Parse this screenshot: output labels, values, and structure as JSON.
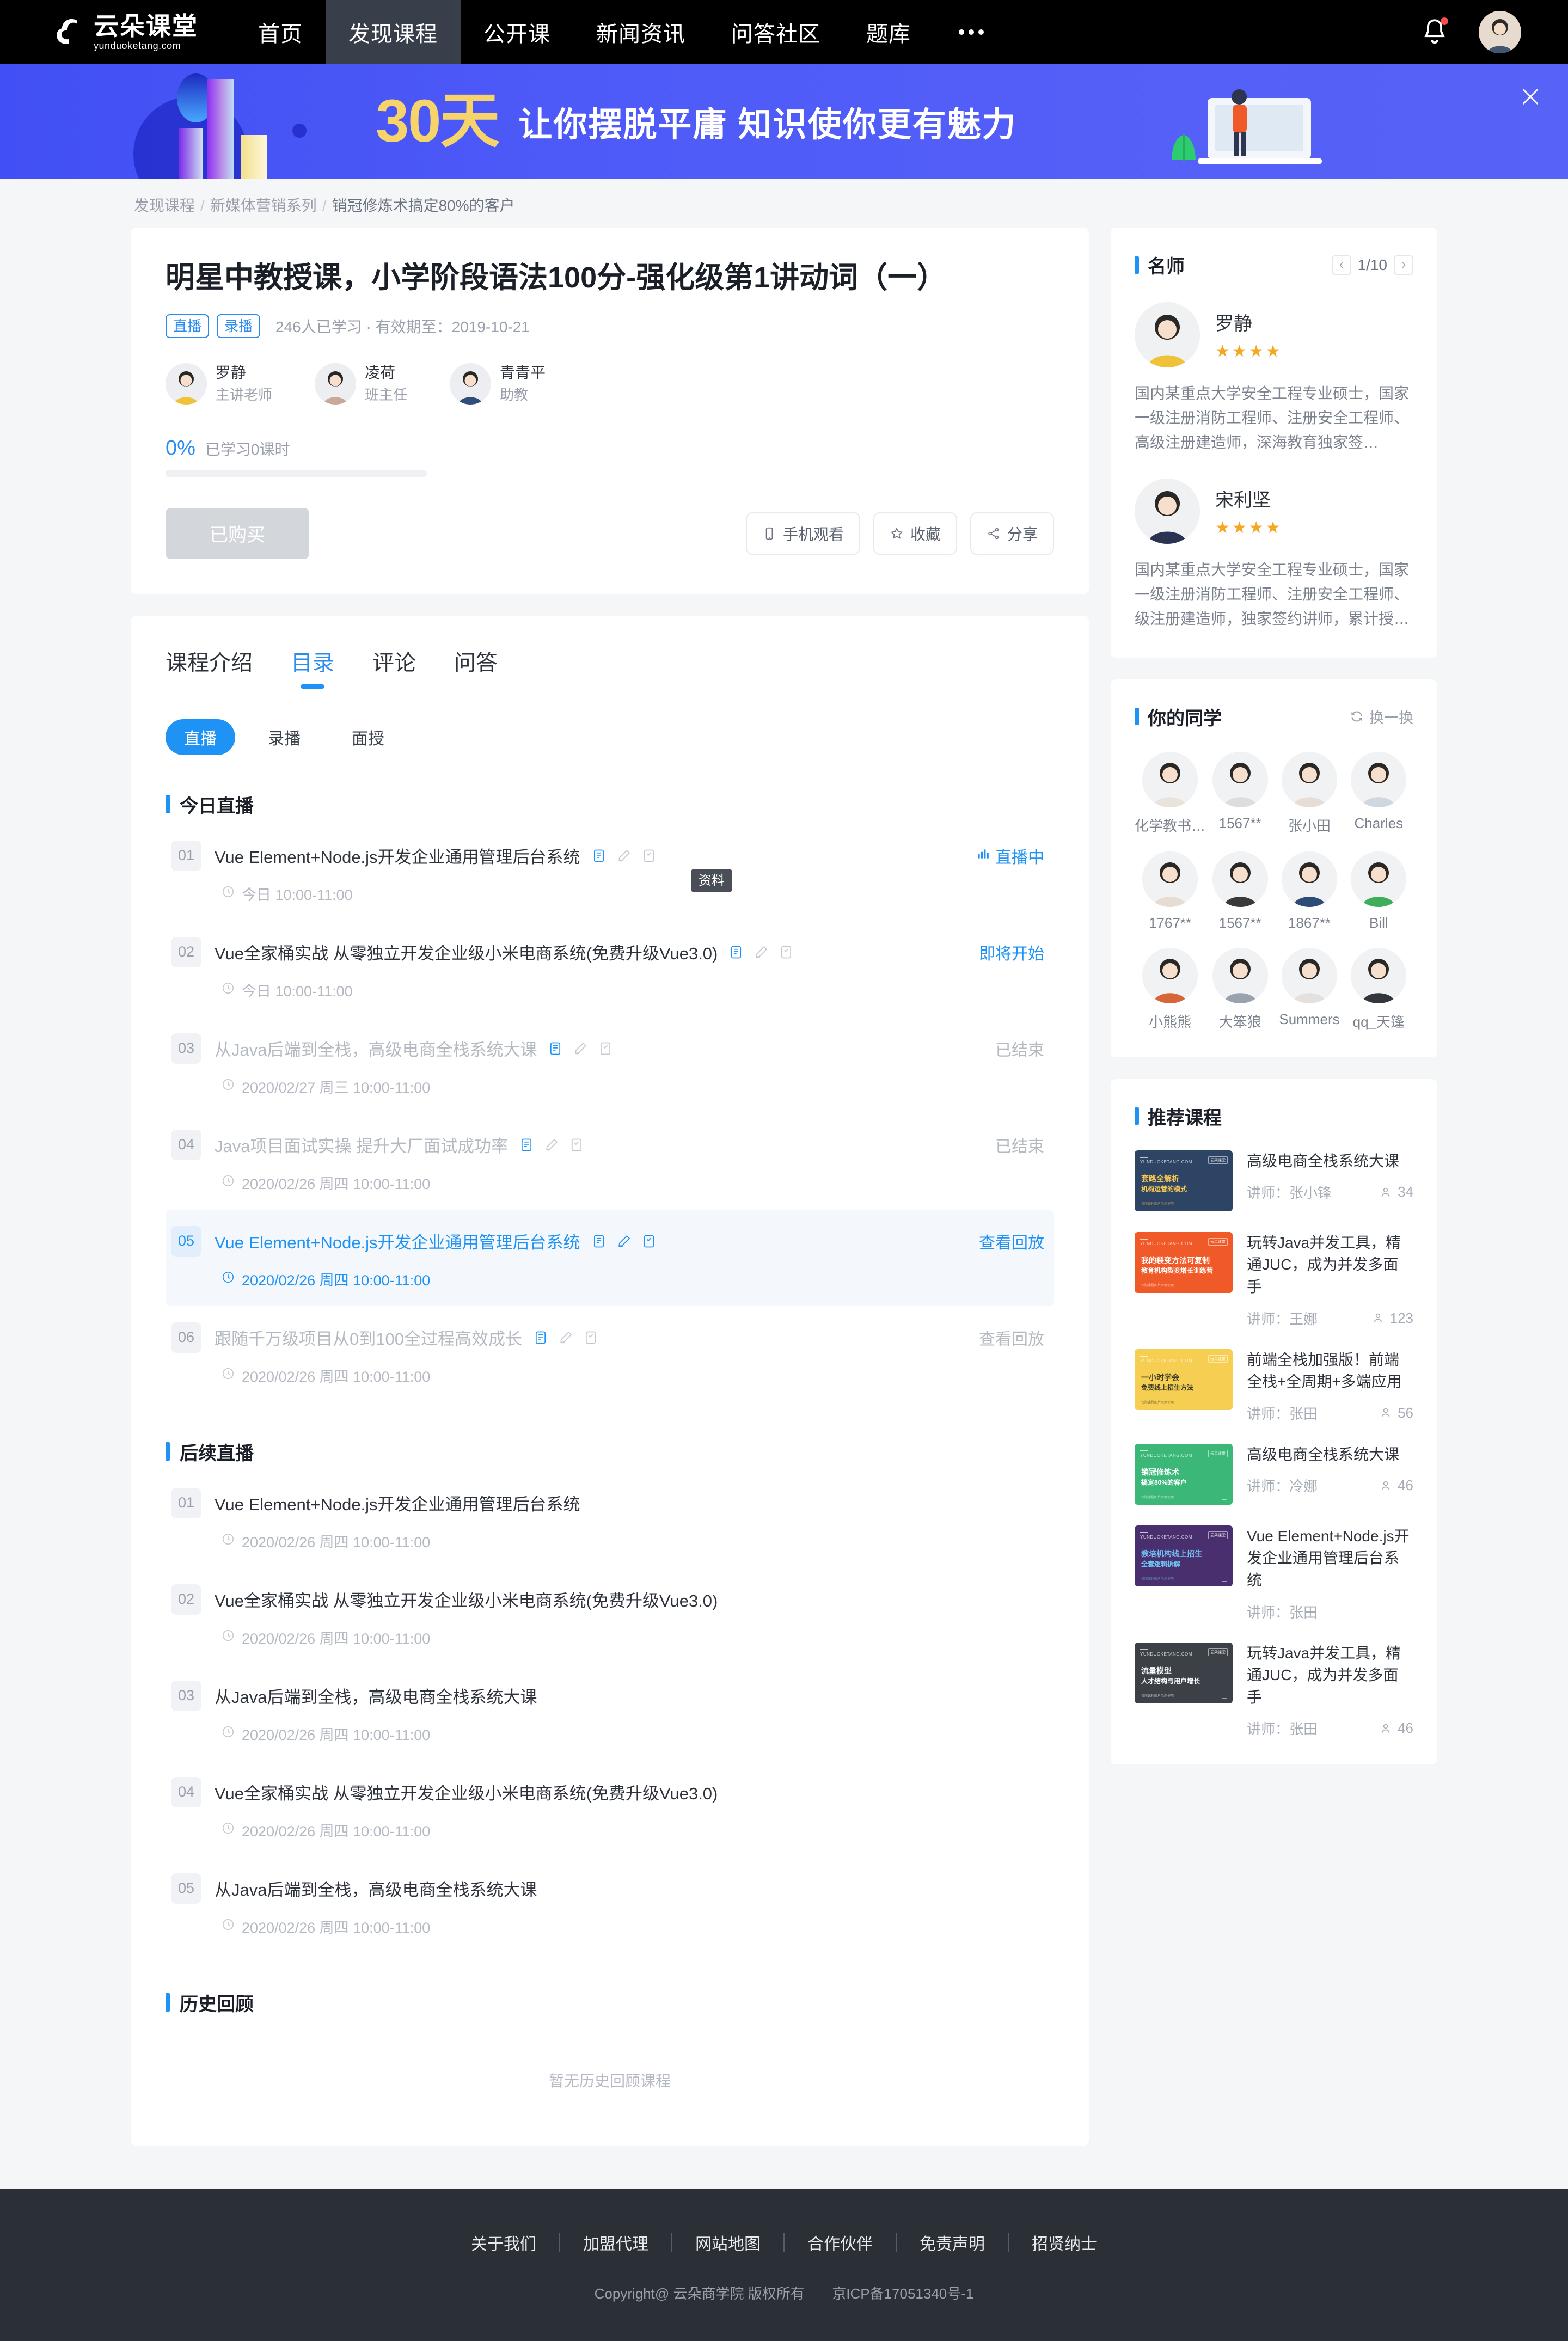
{
  "nav": {
    "logo_cn": "云朵课堂",
    "logo_en": "yunduoketang.com",
    "items": [
      {
        "label": "首页",
        "active": false
      },
      {
        "label": "发现课程",
        "active": true
      },
      {
        "label": "公开课",
        "active": false
      },
      {
        "label": "新闻资讯",
        "active": false
      },
      {
        "label": "问答社区",
        "active": false
      },
      {
        "label": "题库",
        "active": false
      }
    ],
    "more_label": "•••"
  },
  "banner": {
    "days": "30",
    "days_unit": "天",
    "message": "让你摆脱平庸  知识使你更有魅力",
    "accent": "#f7d46a",
    "bg": "#4b57f6"
  },
  "breadcrumb": {
    "items": [
      "发现课程",
      "新媒体营销系列",
      "销冠修炼术搞定80%的客户"
    ],
    "separator": "/"
  },
  "course": {
    "title": "明星中教授课，小学阶段语法100分-强化级第1讲动词（一）",
    "tags": [
      "直播",
      "录播"
    ],
    "meta": "246人已学习 · 有效期至：2019-10-21",
    "teachers": [
      {
        "name": "罗静",
        "role": "主讲老师"
      },
      {
        "name": "凌荷",
        "role": "班主任"
      },
      {
        "name": "青青平",
        "role": "助教"
      }
    ],
    "progress_percent": "0%",
    "progress_label": "已学习0课时",
    "progress_value": 0,
    "buy_button": "已购买",
    "actions": [
      {
        "label": "手机观看",
        "icon": "mobile-icon"
      },
      {
        "label": "收藏",
        "icon": "star-icon"
      },
      {
        "label": "分享",
        "icon": "share-icon"
      }
    ]
  },
  "catalog": {
    "tabs": [
      {
        "label": "课程介绍",
        "active": false
      },
      {
        "label": "目录",
        "active": true
      },
      {
        "label": "评论",
        "active": false
      },
      {
        "label": "问答",
        "active": false
      }
    ],
    "subtabs": [
      {
        "label": "直播",
        "active": true
      },
      {
        "label": "录播",
        "active": false
      },
      {
        "label": "面授",
        "active": false
      }
    ],
    "tooltip": "资料",
    "sections": [
      {
        "title": "今日直播",
        "lessons": [
          {
            "num": "01",
            "title": "Vue Element+Node.js开发企业通用管理后台系统",
            "time": "今日 10:00-11:00",
            "status": "直播中",
            "state": "live",
            "icons": true
          },
          {
            "num": "02",
            "title": "Vue全家桶实战 从零独立开发企业级小米电商系统(免费升级Vue3.0)",
            "time": "今日 10:00-11:00",
            "status": "即将开始",
            "state": "soon",
            "icons": true
          },
          {
            "num": "03",
            "title": "从Java后端到全栈，高级电商全栈系统大课",
            "time": "2020/02/27 周三 10:00-11:00",
            "status": "已结束",
            "state": "ended",
            "icons": true
          },
          {
            "num": "04",
            "title": "Java项目面试实操 提升大厂面试成功率",
            "time": "2020/02/26 周四 10:00-11:00",
            "status": "已结束",
            "state": "ended",
            "icons": true
          },
          {
            "num": "05",
            "title": "Vue Element+Node.js开发企业通用管理后台系统",
            "time": "2020/02/26 周四 10:00-11:00",
            "status": "查看回放",
            "state": "active",
            "icons": true
          },
          {
            "num": "06",
            "title": "跟随千万级项目从0到100全过程高效成长",
            "time": "2020/02/26 周四 10:00-11:00",
            "status": "查看回放",
            "state": "replay",
            "icons": true
          }
        ]
      },
      {
        "title": "后续直播",
        "lessons": [
          {
            "num": "01",
            "title": "Vue Element+Node.js开发企业通用管理后台系统",
            "time": "2020/02/26 周四 10:00-11:00",
            "status": "",
            "state": "plain",
            "icons": false
          },
          {
            "num": "02",
            "title": "Vue全家桶实战 从零独立开发企业级小米电商系统(免费升级Vue3.0)",
            "time": "2020/02/26 周四 10:00-11:00",
            "status": "",
            "state": "plain",
            "icons": false
          },
          {
            "num": "03",
            "title": "从Java后端到全栈，高级电商全栈系统大课",
            "time": "2020/02/26 周四 10:00-11:00",
            "status": "",
            "state": "plain",
            "icons": false
          },
          {
            "num": "04",
            "title": "Vue全家桶实战 从零独立开发企业级小米电商系统(免费升级Vue3.0)",
            "time": "2020/02/26 周四 10:00-11:00",
            "status": "",
            "state": "plain",
            "icons": false
          },
          {
            "num": "05",
            "title": "从Java后端到全栈，高级电商全栈系统大课",
            "time": "2020/02/26 周四 10:00-11:00",
            "status": "",
            "state": "plain",
            "icons": false
          }
        ]
      },
      {
        "title": "历史回顾",
        "lessons": [],
        "empty_text": "暂无历史回顾课程"
      }
    ]
  },
  "sidebar": {
    "famous_teachers": {
      "title": "名师",
      "pager": "1/10",
      "prev_icon": "chevron-left-icon",
      "next_icon": "chevron-right-icon",
      "list": [
        {
          "name": "罗静",
          "stars": 4,
          "desc": "国内某重点大学安全工程专业硕士，国家一级注册消防工程师、注册安全工程师、高级注册建造师，深海教育独家签…",
          "avatar_color": "#f0c23a"
        },
        {
          "name": "宋利坚",
          "stars": 4,
          "desc": "国内某重点大学安全工程专业硕士，国家一级注册消防工程师、注册安全工程师、级注册建造师，独家签约讲师，累计授…",
          "avatar_color": "#2b3352"
        }
      ]
    },
    "classmates": {
      "title": "你的同学",
      "refresh_label": "换一换",
      "refresh_icon": "refresh-icon",
      "list": [
        {
          "name": "化学教书…",
          "color": "#e9e3dc"
        },
        {
          "name": "1567**",
          "color": "#dddddd"
        },
        {
          "name": "张小田",
          "color": "#e8ddd4"
        },
        {
          "name": "Charles",
          "color": "#cfd8e0"
        },
        {
          "name": "1767**",
          "color": "#e6dcd2"
        },
        {
          "name": "1567**",
          "color": "#3a3a3a"
        },
        {
          "name": "1867**",
          "color": "#2e4c78"
        },
        {
          "name": "Bill",
          "color": "#3fae5a"
        },
        {
          "name": "小熊熊",
          "color": "#d6663a"
        },
        {
          "name": "大笨狼",
          "color": "#9aa3ad"
        },
        {
          "name": "Summers",
          "color": "#e3e0dd"
        },
        {
          "name": "qq_天篷",
          "color": "#33363b"
        }
      ]
    },
    "recommended": {
      "title": "推荐课程",
      "list": [
        {
          "title": "高级电商全栈系统大课",
          "teacher_label": "讲师：张小锋",
          "count": "34",
          "thumb_bg": "#2e4464",
          "thumb_line1": "套路全解析",
          "thumb_line2": "机构运营的模式",
          "thumb_text_color": "#f4c64f",
          "badge": "云朵课堂"
        },
        {
          "title": "玩转Java并发工具，精通JUC，成为并发多面手",
          "teacher_label": "讲师：王娜",
          "count": "123",
          "thumb_bg": "#f05a28",
          "thumb_line1": "我的裂变方法可复制",
          "thumb_line2": "教育机构裂变增长训练营",
          "thumb_text_color": "#ffffff",
          "badge": "云朵课堂"
        },
        {
          "title": "前端全栈加强版！前端全栈+全周期+多端应用",
          "teacher_label": "讲师：张田",
          "count": "56",
          "thumb_bg": "#f6cf52",
          "thumb_line1": "一小时学会",
          "thumb_line2": "免费线上招生方法",
          "thumb_text_color": "#3a3a2a",
          "badge": "云朵课堂"
        },
        {
          "title": "高级电商全栈系统大课",
          "teacher_label": "讲师：冷娜",
          "count": "46",
          "thumb_bg": "#3bb878",
          "thumb_line1": "销冠修炼术",
          "thumb_line2": "搞定80%的客户",
          "thumb_text_color": "#ffffff",
          "badge": "云朵课堂"
        },
        {
          "title": "Vue Element+Node.js开发企业通用管理后台系统",
          "teacher_label": "讲师：张田",
          "count": "",
          "thumb_bg": "#4a2f6e",
          "thumb_line1": "教培机构线上招生",
          "thumb_line2": "全套逻辑拆解",
          "thumb_text_color": "#6fc2f2",
          "badge": "云朵课堂"
        },
        {
          "title": "玩转Java并发工具，精通JUC，成为并发多面手",
          "teacher_label": "讲师：张田",
          "count": "46",
          "thumb_bg": "#3c4148",
          "thumb_line1": "流量模型",
          "thumb_line2": "人才结构与用户增长",
          "thumb_text_color": "#ffffff",
          "badge": "云朵课堂"
        }
      ]
    }
  },
  "footer": {
    "links": [
      "关于我们",
      "加盟代理",
      "网站地图",
      "合作伙伴",
      "免责声明",
      "招贤纳士"
    ],
    "copyright": "Copyright@ 云朵商学院   版权所有",
    "icp": "京ICP备17051340号-1"
  }
}
